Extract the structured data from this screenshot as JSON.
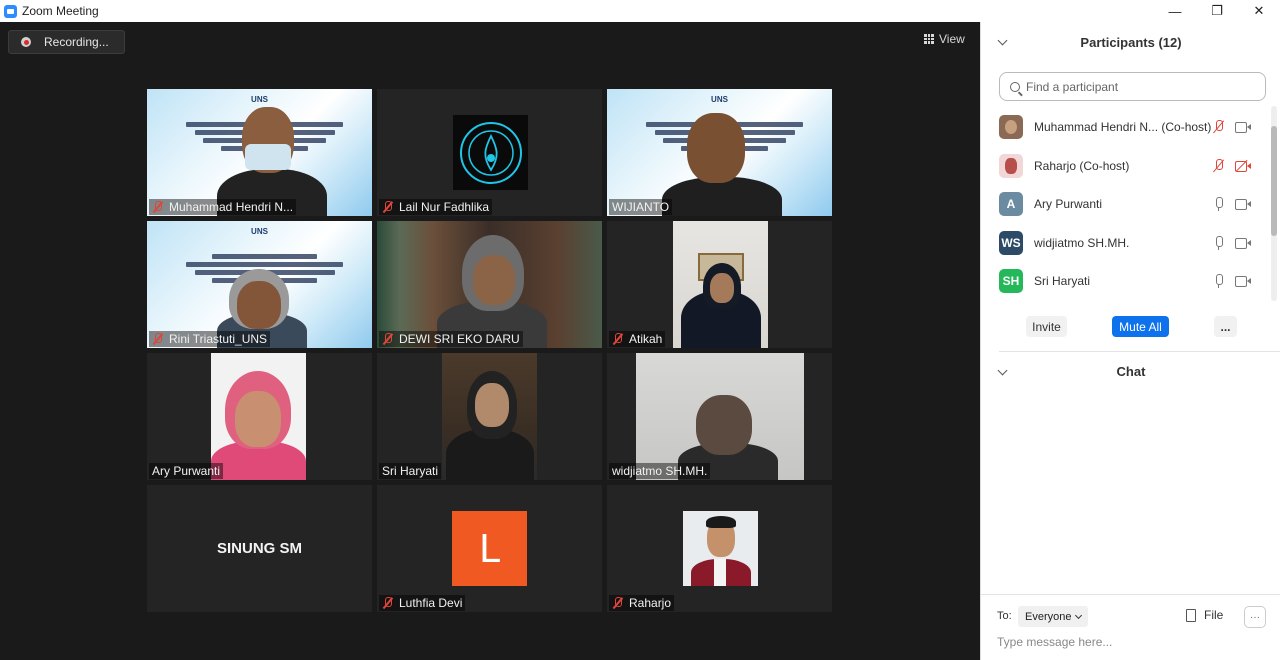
{
  "window": {
    "title": "Zoom Meeting",
    "minimize": "—",
    "restore": "❐",
    "close": "✕"
  },
  "toolbar": {
    "recording_label": "Recording...",
    "view_label": "View"
  },
  "tiles": [
    {
      "name": "Muhammad Hendri N...",
      "muted": true
    },
    {
      "name": "Lail Nur Fadhlika",
      "muted": true
    },
    {
      "name": "WIJIANTO",
      "muted": false,
      "active": true
    },
    {
      "name": "Rini Triastuti_UNS",
      "muted": true
    },
    {
      "name": "DEWI SRI EKO DARU",
      "muted": true
    },
    {
      "name": "Atikah",
      "muted": true
    },
    {
      "name": "Ary Purwanti",
      "muted": false
    },
    {
      "name": "Sri Haryati",
      "muted": false
    },
    {
      "name": "widjiatmo SH.MH.",
      "muted": false
    },
    {
      "name": "",
      "center_label": "SINUNG SM"
    },
    {
      "name": "Luthfia Devi",
      "muted": true,
      "avatar_letter": "L"
    },
    {
      "name": "Raharjo",
      "muted": true
    }
  ],
  "slide": {
    "logo": "UNS"
  },
  "participants_panel": {
    "title": "Participants (12)",
    "search_placeholder": "Find a participant",
    "items": [
      {
        "name": "Muhammad Hendri N... (Co-host)",
        "avatar_letters": "",
        "avatar_color": "#8a6a55"
      },
      {
        "name": "Raharjo (Co-host)",
        "avatar_letters": "",
        "avatar_color": "#b7504a"
      },
      {
        "name": "Ary Purwanti",
        "avatar_letters": "A",
        "avatar_color": "#6a8ba0"
      },
      {
        "name": "widjiatmo SH.MH.",
        "avatar_letters": "WS",
        "avatar_color": "#2d4a66"
      },
      {
        "name": "Sri Haryati",
        "avatar_letters": "SH",
        "avatar_color": "#25b85a"
      }
    ],
    "invite_label": "Invite",
    "mute_all_label": "Mute All",
    "more_label": "..."
  },
  "chat": {
    "title": "Chat",
    "to_label": "To:",
    "to_value": "Everyone",
    "file_label": "File",
    "more_label": "···",
    "input_placeholder": "Type message here..."
  },
  "colors": {
    "accent": "#0e72ed",
    "active_speaker": "#f7f783",
    "muted": "#e0453a"
  }
}
